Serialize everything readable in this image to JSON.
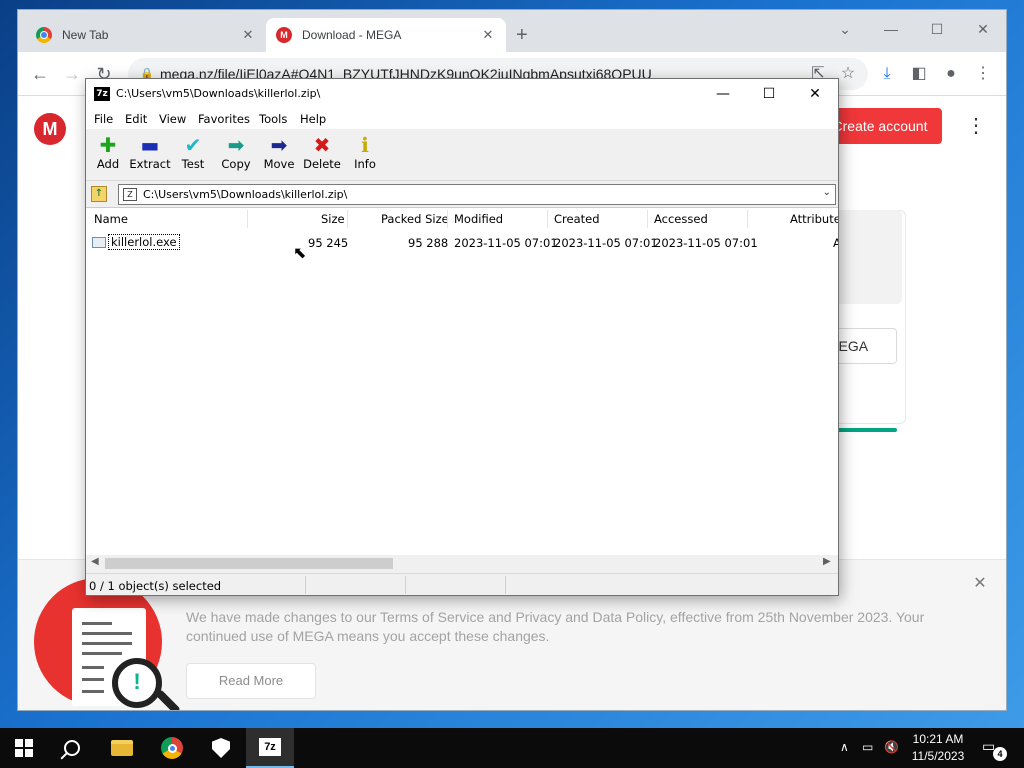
{
  "chrome": {
    "tabs": [
      {
        "label": "New Tab",
        "favicon": "chrome-icon"
      },
      {
        "label": "Download - MEGA",
        "favicon": "mega-icon"
      }
    ],
    "new_tab_glyph": "+",
    "url": "mega.nz/file/IiEl0azA#O4N1_BZYUTfJHNDzK9unQK2juINgbmApsutxi68QPUU",
    "window_controls": {
      "minimize": "—",
      "maximize": "☐",
      "close": "✕"
    }
  },
  "mega_page": {
    "logo": "M",
    "create_account_label": "Create account",
    "side_button_label": "MEGA",
    "banner_text": "We have made changes to our Terms of Service and Privacy and Data Policy, effective from 25th November 2023. Your continued use of MEGA means you accept these changes.",
    "read_more_label": "Read More",
    "accent_color": "#d9272e"
  },
  "zip_window": {
    "title": "C:\\Users\\vm5\\Downloads\\killerlol.zip\\",
    "menu": [
      "File",
      "Edit",
      "View",
      "Favorites",
      "Tools",
      "Help"
    ],
    "toolbar": [
      {
        "label": "Add",
        "icon": "plus-icon",
        "glyph": "✚",
        "color": "#1ea51e"
      },
      {
        "label": "Extract",
        "icon": "minus-icon",
        "glyph": "▬",
        "color": "#1b2fb5"
      },
      {
        "label": "Test",
        "icon": "check-icon",
        "glyph": "✔",
        "color": "#21b6c4"
      },
      {
        "label": "Copy",
        "icon": "copy-arrow-icon",
        "glyph": "➡",
        "color": "#1a9a8a"
      },
      {
        "label": "Move",
        "icon": "move-arrow-icon",
        "glyph": "➡",
        "color": "#1b2a8f"
      },
      {
        "label": "Delete",
        "icon": "delete-x-icon",
        "glyph": "✖",
        "color": "#d41a1a"
      },
      {
        "label": "Info",
        "icon": "info-icon",
        "glyph": "ℹ",
        "color": "#c9a800"
      }
    ],
    "address": "C:\\Users\\vm5\\Downloads\\killerlol.zip\\",
    "columns": [
      "Name",
      "Size",
      "Packed Size",
      "Modified",
      "Created",
      "Accessed",
      "Attribute"
    ],
    "rows": [
      {
        "name": "killerlol.exe",
        "size": "95 245",
        "packed": "95 288",
        "modified": "2023-11-05 07:01",
        "created": "2023-11-05 07:01",
        "accessed": "2023-11-05 07:01",
        "attr": "A"
      }
    ],
    "status": "0 / 1 object(s) selected"
  },
  "taskbar": {
    "apps": [
      "start-button",
      "search-icon",
      "file-explorer-icon",
      "chrome-icon",
      "security-icon",
      "7zip-icon"
    ],
    "zip_label": "7z",
    "time": "10:21 AM",
    "date": "11/5/2023",
    "notification_count": "4"
  }
}
